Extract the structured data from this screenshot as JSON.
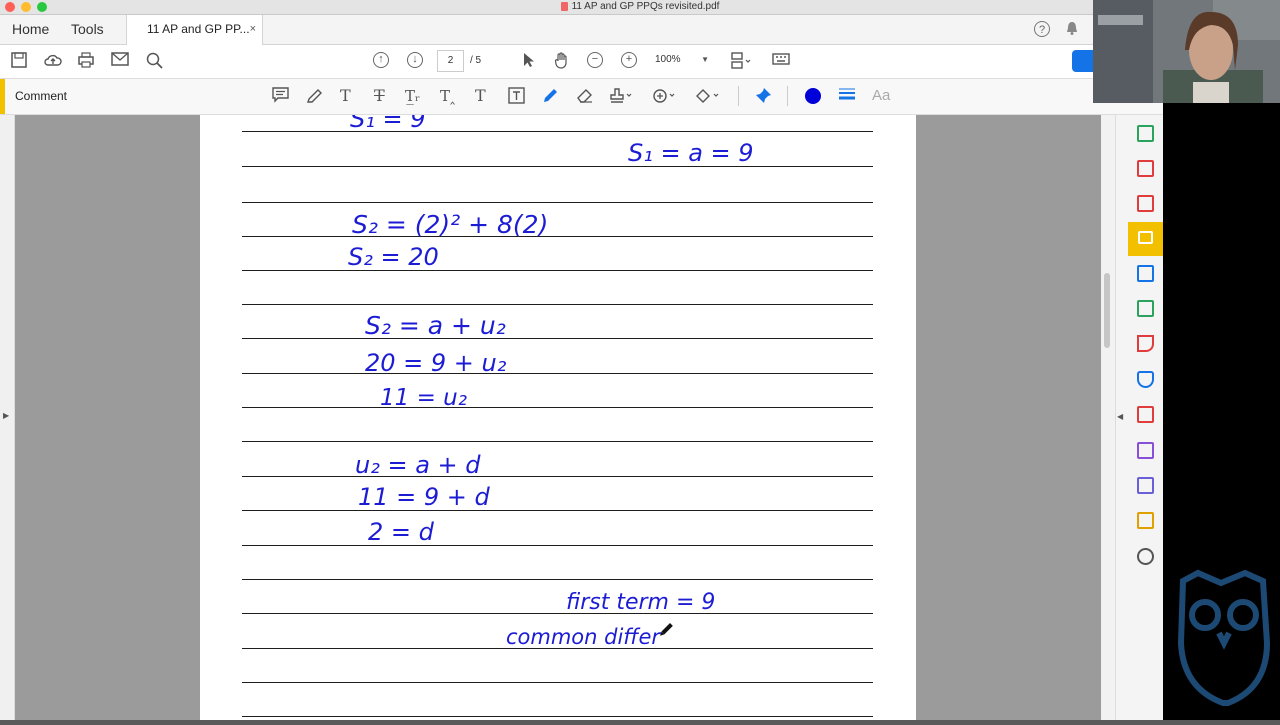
{
  "window": {
    "title": "11 AP and GP PPQs revisited.pdf"
  },
  "tabs": {
    "home": "Home",
    "tools": "Tools",
    "document": "11 AP and GP PP...",
    "close": "×"
  },
  "header_icons": {
    "help": "?"
  },
  "toolbar": {
    "current_page": "2",
    "total_pages": "/ 5",
    "zoom": "100%"
  },
  "comment_toolbar": {
    "label": "Comment",
    "text_tool": "Aa",
    "annotation_color": "#0000d9"
  },
  "icons": [
    "save-icon",
    "upload-icon",
    "print-icon",
    "email-icon",
    "search-icon",
    "arrow-up-icon",
    "arrow-down-icon",
    "select-icon",
    "hand-icon",
    "zoom-out-icon",
    "zoom-in-icon",
    "page-display-icon",
    "keyboard-icon",
    "sticky-note-icon",
    "highlighter-icon",
    "text-icon",
    "strikethrough-icon",
    "replace-text-icon",
    "insert-text-icon",
    "add-text-icon",
    "text-box-icon",
    "pen-icon",
    "eraser-icon",
    "stamp-icon",
    "attach-icon",
    "shapes-icon",
    "pin-icon",
    "line-style-icon"
  ],
  "handwriting": {
    "s1_top": "S₁ = 9",
    "s1_right": "S₁ = a = 9",
    "s2_sub": "S₂ = (2)² + 8(2)",
    "s2_val": "S₂ = 20",
    "eq1": "S₂ = a + u₂",
    "eq2": "20 = 9 + u₂",
    "eq3": "11 = u₂",
    "eq4": "u₂ = a + d",
    "eq5": "11 = 9 + d",
    "eq6": "2 = d",
    "first_term": "first term = 9",
    "common_diff": "common differ"
  },
  "colors": {
    "ink": "#1c1cd4",
    "accent": "#f3c000",
    "share": "#1473e6"
  }
}
